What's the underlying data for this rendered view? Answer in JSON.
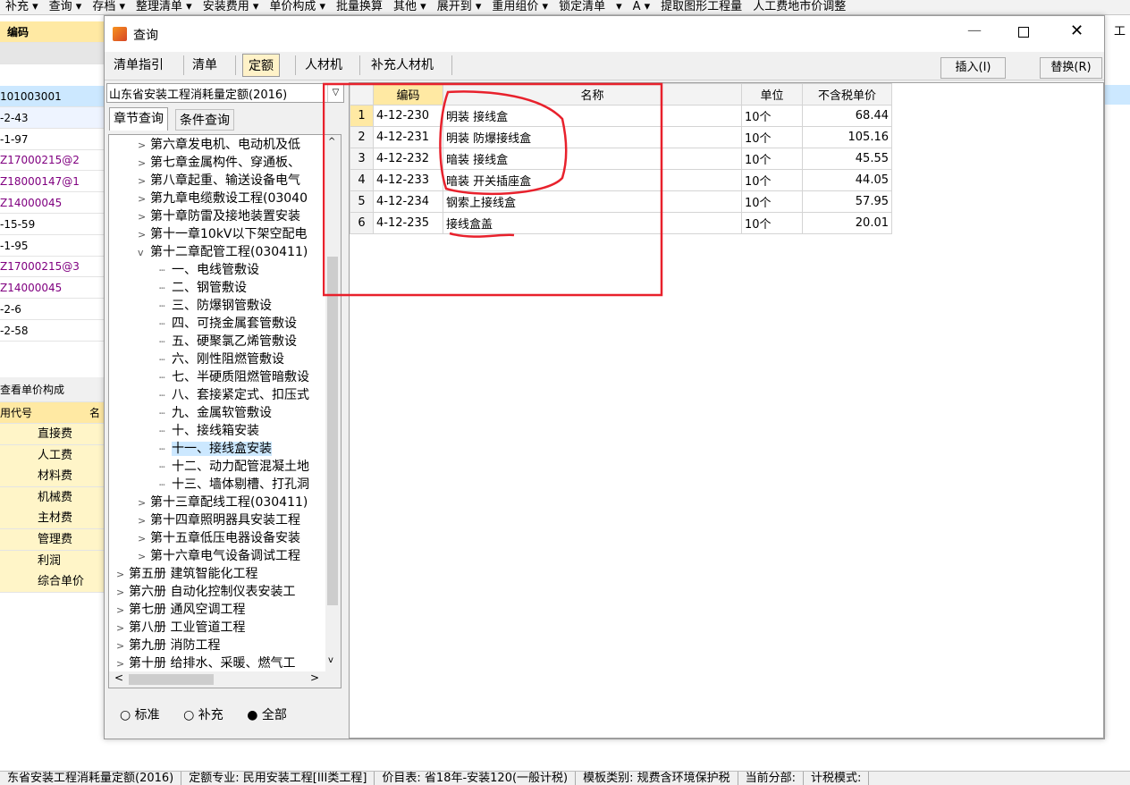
{
  "top_toolbar": {
    "items": [
      "补充 ▾",
      "查询 ▾",
      "存档 ▾",
      "整理清单 ▾",
      "安装费用 ▾",
      "单价构成 ▾",
      "批量换算",
      "其他 ▾",
      "展开到 ▾",
      "重用组价 ▾",
      "锁定清单",
      "▾",
      "A ▾",
      "提取图形工程量",
      "人工费地市价调整"
    ]
  },
  "background_grid": {
    "header": "编码",
    "rows": [
      "101003001",
      "-2-43",
      "-1-97",
      "Z17000215@2",
      "Z18000147@1",
      "Z14000045",
      "-15-59",
      "-1-95",
      "Z17000215@3",
      "Z14000045",
      "-2-6",
      "-2-58"
    ],
    "bottom_tabs": [
      "查看单价构成"
    ],
    "bottom_header": "用代号",
    "bottom_header_2": "名",
    "cost_items": [
      "直接费",
      "人工费",
      "材料费",
      "机械费",
      "主材费",
      "管理费",
      "利润",
      "综合单价"
    ],
    "right_label": "工"
  },
  "dialog": {
    "title": "查询",
    "tabs": [
      "清单指引",
      "清单",
      "定额",
      "人材机",
      "补充人材机"
    ],
    "active_tab": "定额",
    "insert_button": "插入(I)",
    "replace_button": "替换(R)",
    "library_select": "山东省安装工程消耗量定额(2016)",
    "sub_tabs": [
      "章节查询",
      "条件查询"
    ],
    "tree": [
      {
        "label": "第六章发电机、电动机及低",
        "level": 1,
        "expand": ">"
      },
      {
        "label": "第七章金属构件、穿通板、",
        "level": 1,
        "expand": ">"
      },
      {
        "label": "第八章起重、输送设备电气",
        "level": 1,
        "expand": ">"
      },
      {
        "label": "第九章电缆敷设工程(03040",
        "level": 1,
        "expand": ">"
      },
      {
        "label": "第十章防雷及接地装置安装",
        "level": 1,
        "expand": ">"
      },
      {
        "label": "第十一章10kV以下架空配电",
        "level": 1,
        "expand": ">"
      },
      {
        "label": "第十二章配管工程(030411)",
        "level": 1,
        "expand": "v"
      },
      {
        "label": "一、电线管敷设",
        "level": 2,
        "expand": ""
      },
      {
        "label": "二、钢管敷设",
        "level": 2,
        "expand": ""
      },
      {
        "label": "三、防爆钢管敷设",
        "level": 2,
        "expand": ""
      },
      {
        "label": "四、可挠金属套管敷设",
        "level": 2,
        "expand": ""
      },
      {
        "label": "五、硬聚氯乙烯管敷设",
        "level": 2,
        "expand": ""
      },
      {
        "label": "六、刚性阻燃管敷设",
        "level": 2,
        "expand": ""
      },
      {
        "label": "七、半硬质阻燃管暗敷设",
        "level": 2,
        "expand": ""
      },
      {
        "label": "八、套接紧定式、扣压式",
        "level": 2,
        "expand": ""
      },
      {
        "label": "九、金属软管敷设",
        "level": 2,
        "expand": ""
      },
      {
        "label": "十、接线箱安装",
        "level": 2,
        "expand": ""
      },
      {
        "label": "十一、接线盒安装",
        "level": 2,
        "expand": "",
        "selected": true
      },
      {
        "label": "十二、动力配管混凝土地",
        "level": 2,
        "expand": ""
      },
      {
        "label": "十三、墙体剔槽、打孔洞",
        "level": 2,
        "expand": ""
      },
      {
        "label": "第十三章配线工程(030411)",
        "level": 1,
        "expand": ">"
      },
      {
        "label": "第十四章照明器具安装工程",
        "level": 1,
        "expand": ">"
      },
      {
        "label": "第十五章低压电器设备安装",
        "level": 1,
        "expand": ">"
      },
      {
        "label": "第十六章电气设备调试工程",
        "level": 1,
        "expand": ">"
      },
      {
        "label": "第五册 建筑智能化工程",
        "level": 0,
        "expand": ">"
      },
      {
        "label": "第六册 自动化控制仪表安装工",
        "level": 0,
        "expand": ">"
      },
      {
        "label": "第七册 通风空调工程",
        "level": 0,
        "expand": ">"
      },
      {
        "label": "第八册 工业管道工程",
        "level": 0,
        "expand": ">"
      },
      {
        "label": "第九册 消防工程",
        "level": 0,
        "expand": ">"
      },
      {
        "label": "第十册 给排水、采暖、燃气工",
        "level": 0,
        "expand": ">"
      }
    ],
    "radio_options": [
      "标准",
      "补充",
      "全部"
    ],
    "radio_selected": "全部",
    "table": {
      "columns": [
        "编码",
        "名称",
        "单位",
        "不含税单价"
      ],
      "rows": [
        {
          "no": "1",
          "code": "4-12-230",
          "name": "明装 接线盒",
          "unit": "10个",
          "price": "68.44"
        },
        {
          "no": "2",
          "code": "4-12-231",
          "name": "明装 防爆接线盒",
          "unit": "10个",
          "price": "105.16"
        },
        {
          "no": "3",
          "code": "4-12-232",
          "name": "暗装 接线盒",
          "unit": "10个",
          "price": "45.55"
        },
        {
          "no": "4",
          "code": "4-12-233",
          "name": "暗装 开关插座盒",
          "unit": "10个",
          "price": "44.05"
        },
        {
          "no": "5",
          "code": "4-12-234",
          "name": "钢索上接线盒",
          "unit": "10个",
          "price": "57.95"
        },
        {
          "no": "6",
          "code": "4-12-235",
          "name": "接线盒盖",
          "unit": "10个",
          "price": "20.01"
        }
      ]
    }
  },
  "status_bar": {
    "items": [
      "东省安装工程消耗量定额(2016)",
      "定额专业: 民用安装工程[III类工程]",
      "价目表: 省18年-安装120(一般计税)",
      "模板类别: 规费含环境保护税",
      "当前分部:",
      "计税模式:"
    ]
  },
  "colors": {
    "selected_row": "#cce8ff",
    "tab_highlight": "#fff2c8",
    "header_yellow": "#ffe9a3",
    "annotation_red": "#e8212c",
    "purple_code": "#800080"
  }
}
